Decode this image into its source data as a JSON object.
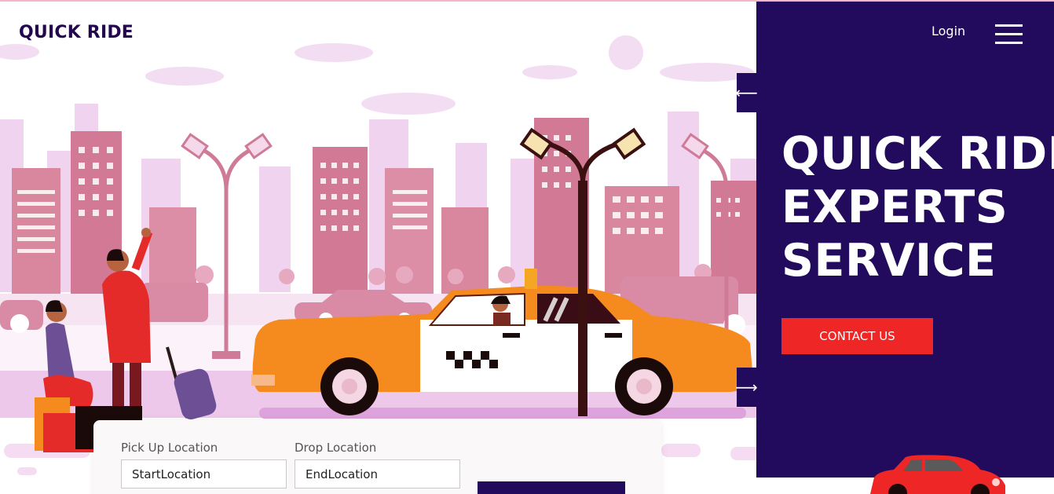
{
  "header": {
    "brand": "QUICK RIDE",
    "login_label": "Login"
  },
  "hero": {
    "headline_lines": [
      "QUICK RIDE",
      "EXPERTS",
      "SERVICE"
    ],
    "contact_label": "CONTACT US",
    "prev_arrow": "⟵",
    "next_arrow": "⟶"
  },
  "booking": {
    "pickup_label": "Pick Up Location",
    "pickup_value": "StartLocation",
    "drop_label": "Drop Location",
    "drop_value": "EndLocation"
  },
  "icons": [
    "hamburger-menu-icon",
    "arrow-left-icon",
    "arrow-right-icon"
  ],
  "colors": {
    "brand_dark": "#220a5c",
    "accent_red": "#ef2626",
    "taxi_orange": "#f58b1f",
    "city_pink": "#d9869f"
  }
}
